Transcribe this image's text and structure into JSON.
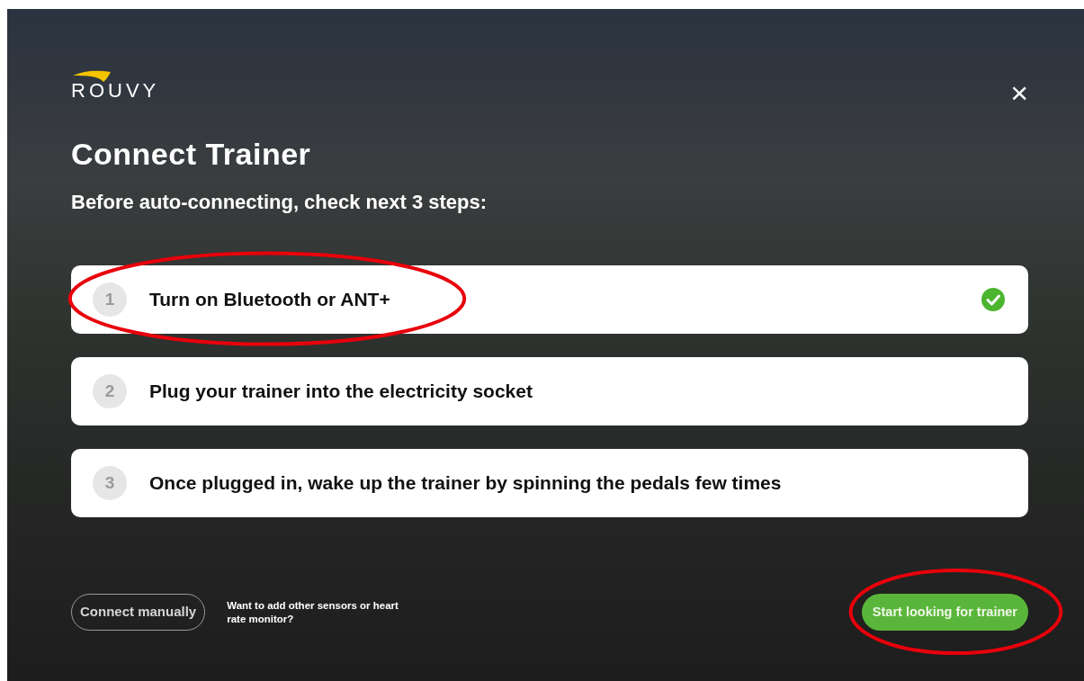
{
  "logo": {
    "text": "ROUVY"
  },
  "close": {
    "label": "×"
  },
  "title": "Connect Trainer",
  "subtitle": "Before auto-connecting, check next 3 steps:",
  "steps": [
    {
      "number": "1",
      "text": "Turn on Bluetooth or ANT+",
      "completed": true,
      "highlighted": true
    },
    {
      "number": "2",
      "text": "Plug your trainer into the electricity socket",
      "completed": false,
      "highlighted": false
    },
    {
      "number": "3",
      "text": "Once plugged in, wake up the trainer by spinning the pedals few times",
      "completed": false,
      "highlighted": false
    }
  ],
  "footer": {
    "manual_button": "Connect manually",
    "hint": "Want to add other sensors or heart rate monitor?",
    "start_button": {
      "label": "Start looking for trainer",
      "highlighted": true
    }
  }
}
